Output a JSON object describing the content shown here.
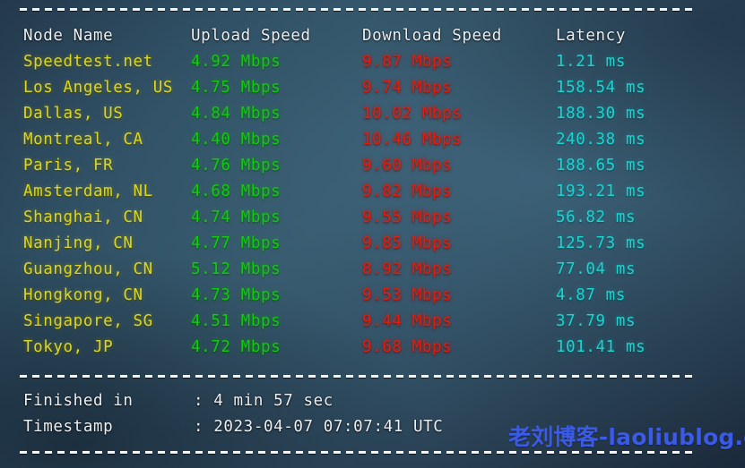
{
  "terminal": {
    "background_color": "#2e4f63",
    "separator_style": "dashed"
  },
  "table": {
    "columns": [
      {
        "key": "node",
        "label": "Node Name",
        "color": "#edf1f4"
      },
      {
        "key": "upload",
        "label": "Upload Speed",
        "color": "#14c814"
      },
      {
        "key": "download",
        "label": "Download Speed",
        "color": "#e01f10"
      },
      {
        "key": "latency",
        "label": "Latency",
        "color": "#1fd3d3"
      }
    ],
    "node_color": "#d9d62b",
    "rows": [
      {
        "node": "Speedtest.net",
        "upload": "4.92 Mbps",
        "download": "9.87 Mbps",
        "latency": "1.21 ms"
      },
      {
        "node": "Los Angeles, US",
        "upload": "4.75 Mbps",
        "download": "9.74 Mbps",
        "latency": "158.54 ms"
      },
      {
        "node": "Dallas, US",
        "upload": "4.84 Mbps",
        "download": "10.02 Mbps",
        "latency": "188.30 ms"
      },
      {
        "node": "Montreal, CA",
        "upload": "4.40 Mbps",
        "download": "10.46 Mbps",
        "latency": "240.38 ms"
      },
      {
        "node": "Paris, FR",
        "upload": "4.76 Mbps",
        "download": "9.60 Mbps",
        "latency": "188.65 ms"
      },
      {
        "node": "Amsterdam, NL",
        "upload": "4.68 Mbps",
        "download": "9.82 Mbps",
        "latency": "193.21 ms"
      },
      {
        "node": "Shanghai, CN",
        "upload": "4.74 Mbps",
        "download": "9.55 Mbps",
        "latency": "56.82 ms"
      },
      {
        "node": "Nanjing, CN",
        "upload": "4.77 Mbps",
        "download": "9.85 Mbps",
        "latency": "125.73 ms"
      },
      {
        "node": "Guangzhou, CN",
        "upload": "5.12 Mbps",
        "download": "8.92 Mbps",
        "latency": "77.04 ms"
      },
      {
        "node": "Hongkong, CN",
        "upload": "4.73 Mbps",
        "download": "9.53 Mbps",
        "latency": "4.87 ms"
      },
      {
        "node": "Singapore, SG",
        "upload": "4.51 Mbps",
        "download": "9.44 Mbps",
        "latency": "37.79 ms"
      },
      {
        "node": "Tokyo, JP",
        "upload": "4.72 Mbps",
        "download": "9.68 Mbps",
        "latency": "101.41 ms"
      }
    ]
  },
  "summary": {
    "finished_label": "Finished in",
    "finished_value": ": 4 min 57 sec",
    "timestamp_label": "Timestamp",
    "timestamp_value": ": 2023-04-07 07:07:41 UTC"
  },
  "watermark": {
    "text": "老刘博客-laoliublog.cn",
    "color": "#3b5ae8"
  }
}
